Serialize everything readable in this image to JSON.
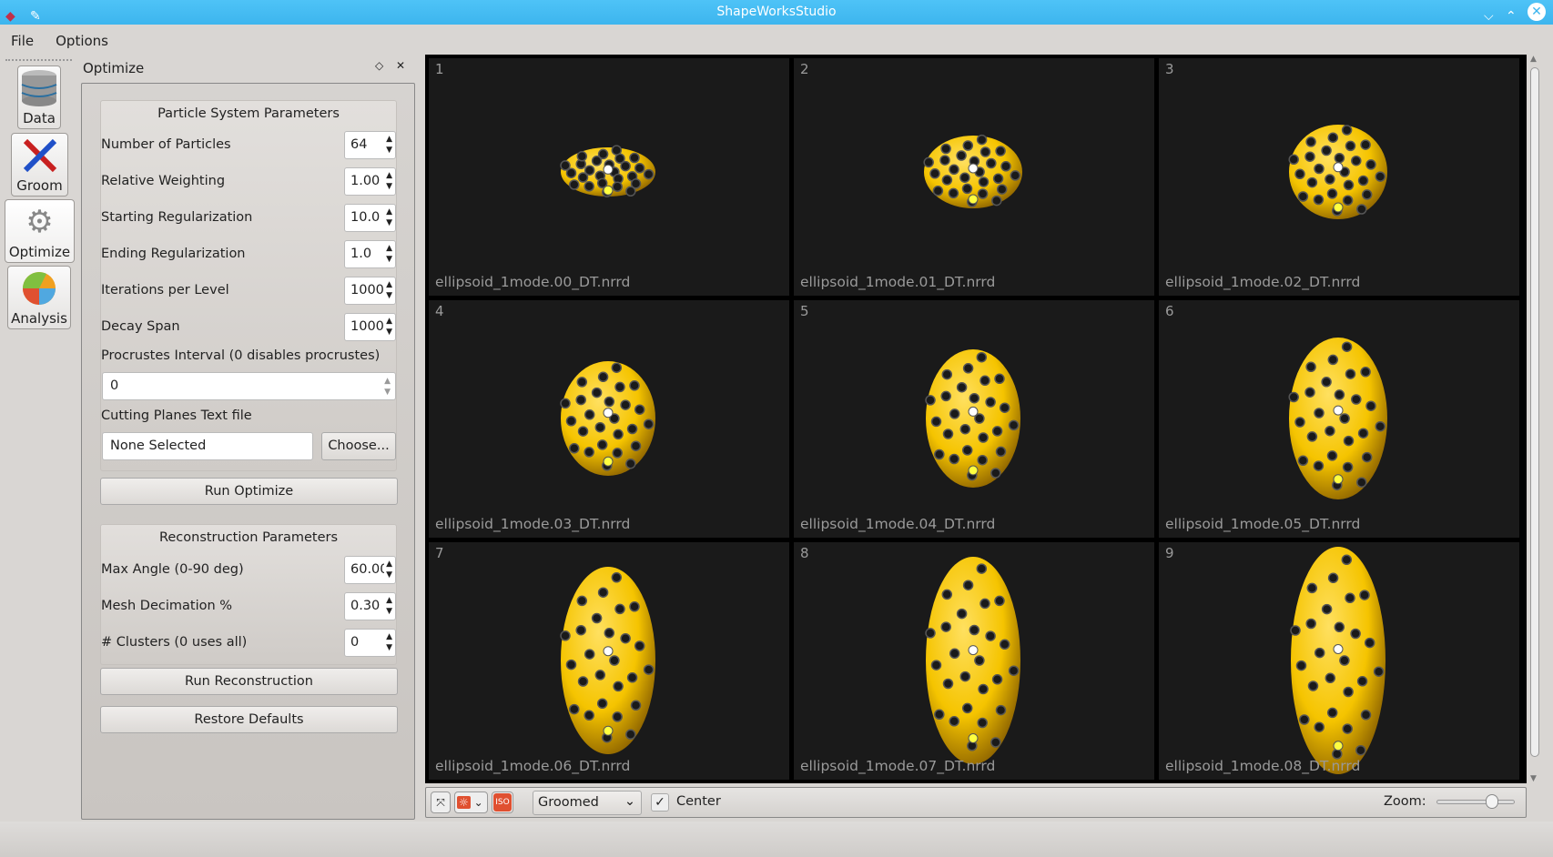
{
  "window": {
    "title": "ShapeWorksStudio"
  },
  "menu": [
    "File",
    "Options"
  ],
  "tools": [
    {
      "label": "Data",
      "icon": "database-icon"
    },
    {
      "label": "Groom",
      "icon": "tools-icon"
    },
    {
      "label": "Optimize",
      "icon": "gears-icon"
    },
    {
      "label": "Analysis",
      "icon": "pie-chart-icon"
    }
  ],
  "active_tool": "Optimize",
  "panel": {
    "title": "Optimize",
    "particle_group": {
      "title": "Particle System Parameters",
      "params": [
        {
          "label": "Number of Particles",
          "value": "64"
        },
        {
          "label": "Relative Weighting",
          "value": "1.00"
        },
        {
          "label": "Starting Regularization",
          "value": "10.0"
        },
        {
          "label": "Ending Regularization",
          "value": "1.0"
        },
        {
          "label": "Iterations per Level",
          "value": "1000"
        },
        {
          "label": "Decay Span",
          "value": "1000"
        }
      ],
      "procrustes_label": "Procrustes Interval (0 disables procrustes)",
      "procrustes_value": "0",
      "cutting_label": "Cutting Planes Text file",
      "cutting_value": "None Selected",
      "choose_label": "Choose..."
    },
    "run_optimize": "Run Optimize",
    "recon_group": {
      "title": "Reconstruction Parameters",
      "params": [
        {
          "label": "Max Angle (0-90 deg)",
          "value": "60.00"
        },
        {
          "label": "Mesh Decimation %",
          "value": "0.30"
        },
        {
          "label": "# Clusters (0 uses all)",
          "value": "0"
        }
      ]
    },
    "run_reconstruction": "Run Reconstruction",
    "restore_defaults": "Restore Defaults"
  },
  "viewer": {
    "cells": [
      {
        "num": "1",
        "file": "ellipsoid_1mode.00_DT.nrrd"
      },
      {
        "num": "2",
        "file": "ellipsoid_1mode.01_DT.nrrd"
      },
      {
        "num": "3",
        "file": "ellipsoid_1mode.02_DT.nrrd"
      },
      {
        "num": "4",
        "file": "ellipsoid_1mode.03_DT.nrrd"
      },
      {
        "num": "5",
        "file": "ellipsoid_1mode.04_DT.nrrd"
      },
      {
        "num": "6",
        "file": "ellipsoid_1mode.05_DT.nrrd"
      },
      {
        "num": "7",
        "file": "ellipsoid_1mode.06_DT.nrrd"
      },
      {
        "num": "8",
        "file": "ellipsoid_1mode.07_DT.nrrd"
      },
      {
        "num": "9",
        "file": "ellipsoid_1mode.08_DT.nrrd"
      }
    ],
    "shape_color": "#f5c400",
    "particle_color": "#1a1a1a"
  },
  "bottom": {
    "display_mode": "Groomed",
    "center_label": "Center",
    "center_checked": true,
    "zoom_label": "Zoom:",
    "zoom_level": 0.7,
    "iso_label": "ISO"
  }
}
